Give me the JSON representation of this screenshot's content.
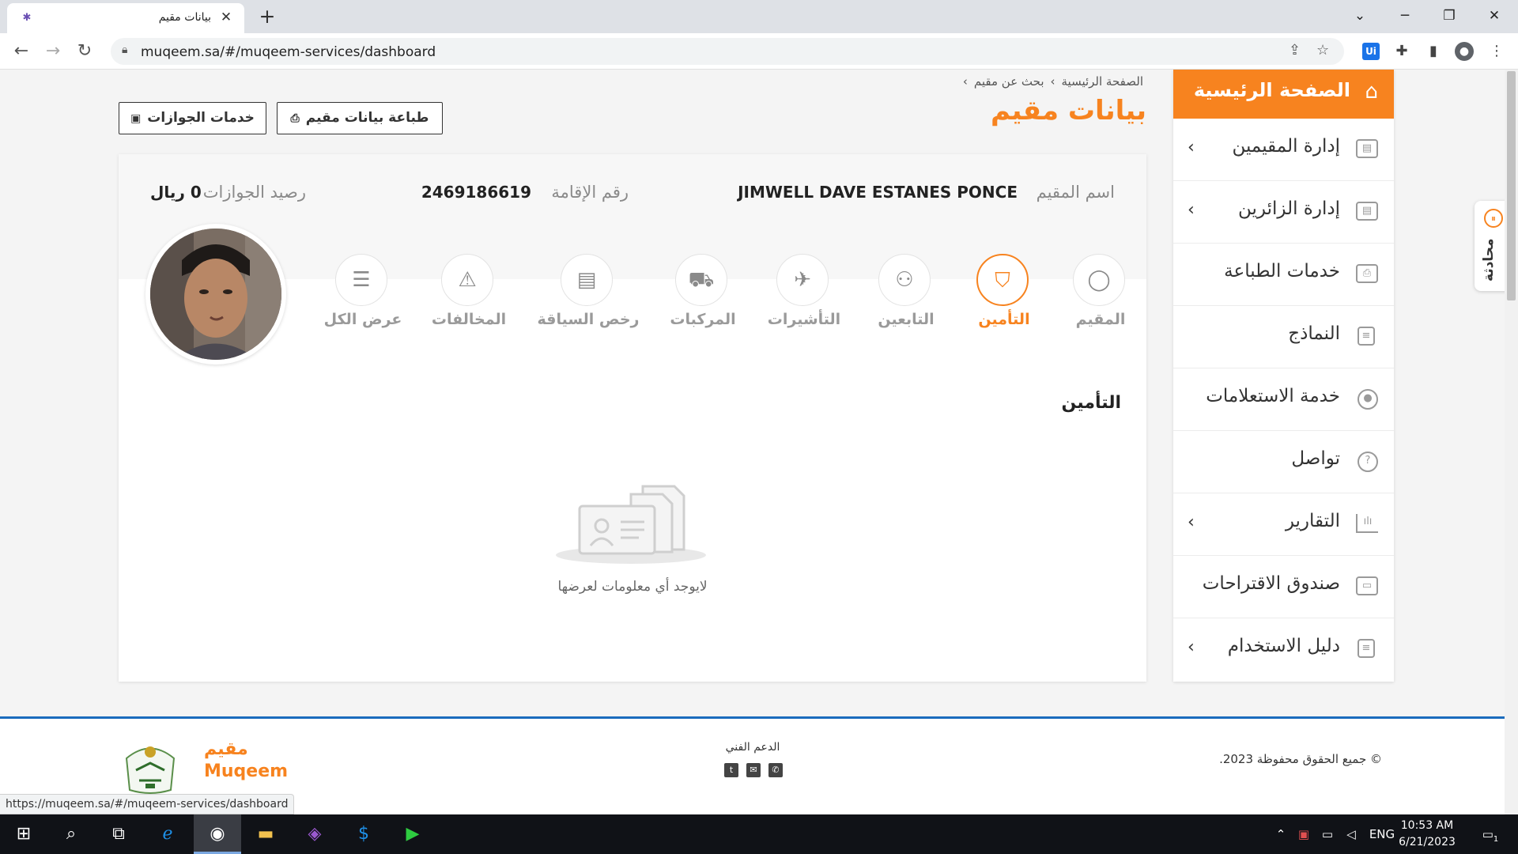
{
  "browser": {
    "tab_title": "بيانات مقيم",
    "url": "muqeem.sa/#/muqeem-services/dashboard",
    "status_url": "https://muqeem.sa/#/muqeem-services/dashboard"
  },
  "breadcrumb": [
    "الصفحة الرئيسية",
    "بحث عن مقيم"
  ],
  "page_title": "بيانات مقيم",
  "buttons": {
    "print_resident": "طباعة بيانات مقيم",
    "passport_services": "خدمات الجوازات"
  },
  "resident": {
    "name_label": "اسم المقيم",
    "name_value": "JIMWELL DAVE ESTANES PONCE",
    "iqama_label": "رقم الإقامة",
    "iqama_value": "2469186619",
    "balance_label": "رصيد الجوازات",
    "balance_value": "0 ريال"
  },
  "tabs": [
    {
      "label": "المقيم",
      "icon": "user-icon"
    },
    {
      "label": "التأمين",
      "icon": "shield-icon",
      "active": true
    },
    {
      "label": "التابعين",
      "icon": "users-icon"
    },
    {
      "label": "التأشيرات",
      "icon": "plane-icon"
    },
    {
      "label": "المركبات",
      "icon": "car-icon"
    },
    {
      "label": "رخص السياقة",
      "icon": "id-card-icon"
    },
    {
      "label": "المخالفات",
      "icon": "warning-icon"
    },
    {
      "label": "عرض الكل",
      "icon": "list-icon"
    }
  ],
  "section": {
    "title": "التأمين",
    "empty_text": "لايوجد أي معلومات لعرضها"
  },
  "sidebar": {
    "home": "الصفحة الرئيسية",
    "items": [
      {
        "label": "إدارة المقيمين",
        "icon": "id-card-icon",
        "has_submenu": true
      },
      {
        "label": "إدارة الزائرين",
        "icon": "id-card-icon",
        "has_submenu": true
      },
      {
        "label": "خدمات الطباعة",
        "icon": "printer-icon",
        "has_submenu": false
      },
      {
        "label": "النماذج",
        "icon": "document-icon",
        "has_submenu": false
      },
      {
        "label": "خدمة الاستعلامات",
        "icon": "eye-icon",
        "has_submenu": false
      },
      {
        "label": "تواصل",
        "icon": "question-icon",
        "has_submenu": false
      },
      {
        "label": "التقارير",
        "icon": "bar-chart-icon",
        "has_submenu": true
      },
      {
        "label": "صندوق الاقتراحات",
        "icon": "inbox-icon",
        "has_submenu": false
      },
      {
        "label": "دليل الاستخدام",
        "icon": "book-icon",
        "has_submenu": true
      }
    ]
  },
  "chat": {
    "label": "محادثة"
  },
  "footer": {
    "copyright": "© جميع الحقوق محفوظة 2023.",
    "support_label": "الدعم الفني",
    "brand_ar": "مقيم",
    "brand_en": "Muqeem"
  },
  "taskbar": {
    "language": "ENG",
    "time": "10:53 AM",
    "date": "6/21/2023",
    "notifications": "1"
  },
  "colors": {
    "accent": "#f7831f",
    "footer_border": "#1a6bbd"
  }
}
